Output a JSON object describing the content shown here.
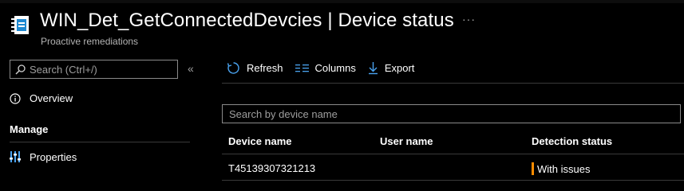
{
  "header": {
    "title": "WIN_Det_GetConnectedDevcies",
    "separator": "|",
    "page_name": "Device status",
    "subtitle": "Proactive remediations",
    "more_label": "···"
  },
  "sidebar": {
    "search_placeholder": "Search (Ctrl+/)",
    "collapse_label": "«",
    "items": [
      {
        "label": "Overview",
        "icon": "info-icon"
      }
    ],
    "section_heading": "Manage",
    "manage_items": [
      {
        "label": "Properties",
        "icon": "properties-sliders-icon"
      }
    ]
  },
  "toolbar": {
    "refresh_label": "Refresh",
    "columns_label": "Columns",
    "export_label": "Export"
  },
  "search": {
    "placeholder": "Search by device name",
    "value": ""
  },
  "table": {
    "columns": [
      "Device name",
      "User name",
      "Detection status"
    ],
    "rows": [
      {
        "device_name": "T45139307321213",
        "user_name": "",
        "detection_status": "With issues",
        "status_color": "#ff8c00"
      }
    ]
  },
  "colors": {
    "background": "#000000",
    "accent": "#4aa3f0",
    "warning": "#ff8c00"
  }
}
